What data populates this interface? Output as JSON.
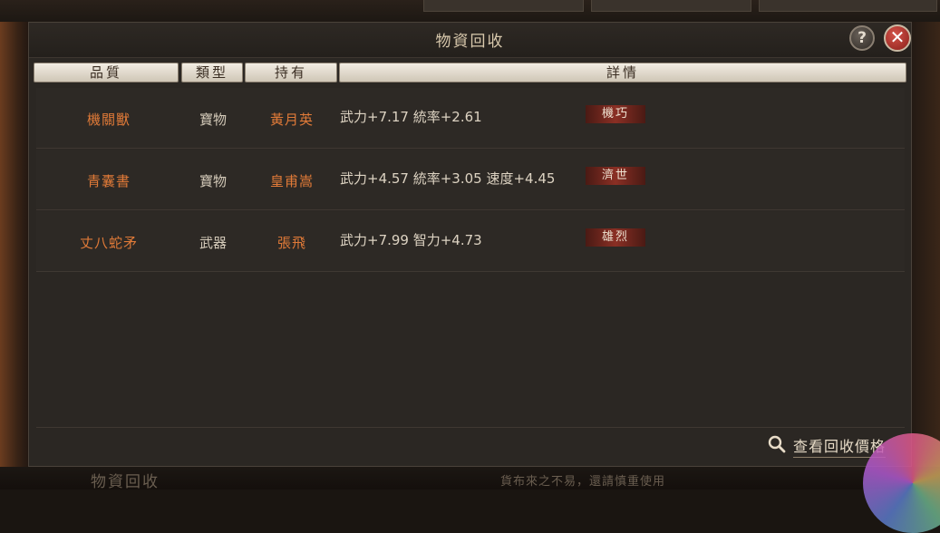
{
  "window": {
    "title": "物資回收",
    "help_label": "?",
    "close_label": "✕",
    "help_icon": "question-icon",
    "close_icon": "close-icon"
  },
  "columns": {
    "quality": "品質",
    "type": "類型",
    "owner": "持有",
    "details": "詳情"
  },
  "rows": [
    {
      "name": "機關獸",
      "type": "寶物",
      "owner": "黃月英",
      "stats": "武力+7.17  統率+2.61",
      "tag": "機巧"
    },
    {
      "name": "青囊書",
      "type": "寶物",
      "owner": "皇甫嵩",
      "stats": "武力+4.57  統率+3.05  速度+4.45",
      "tag": "濟世"
    },
    {
      "name": "丈八蛇矛",
      "type": "武器",
      "owner": "張飛",
      "stats": "武力+7.99  智力+4.73",
      "tag": "雄烈"
    }
  ],
  "footer": {
    "check_prices_label": "查看回收價格",
    "search_icon": "magnifier-icon"
  },
  "background": {
    "title": "物資回收",
    "hint": "貨布來之不易，還請慎重使用"
  },
  "colors": {
    "accent_orange": "#e07a38",
    "panel": "#2b2723",
    "header": "#e6dfd2",
    "close_red": "#b8322a",
    "tag_red": "#8a2f24"
  }
}
